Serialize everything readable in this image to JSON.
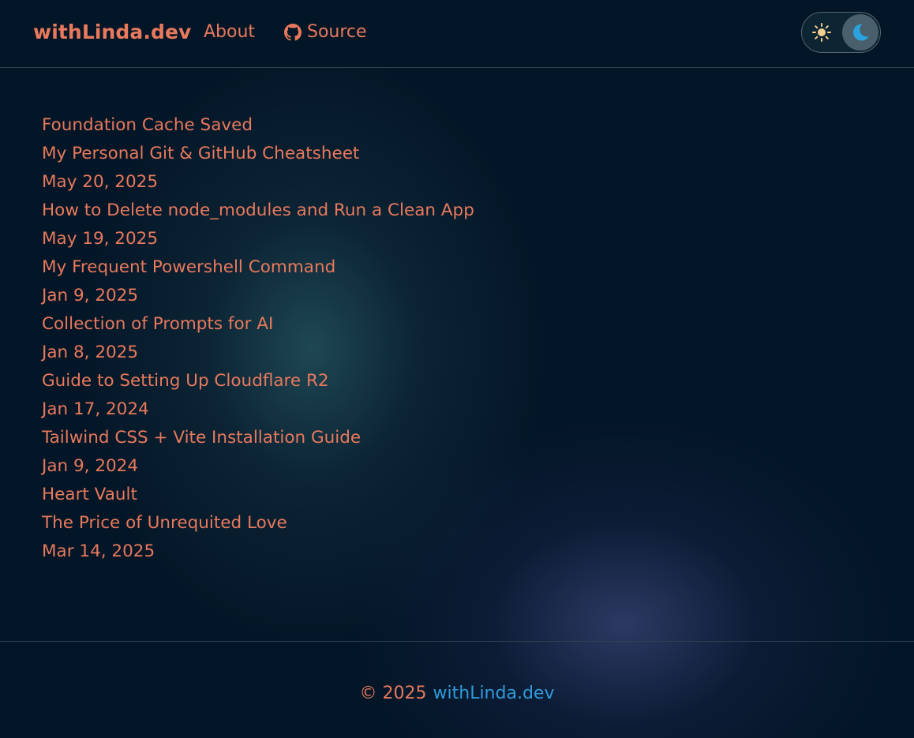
{
  "colors": {
    "accent": "#e8795c",
    "link_blue": "#2f9bd9",
    "background": "#031627",
    "divider": "#2f4250"
  },
  "header": {
    "brand": "withLinda.dev",
    "nav": {
      "about": "About",
      "source": "Source",
      "source_icon": "github-icon"
    },
    "theme_toggle": {
      "options": [
        "light",
        "dark"
      ],
      "selected": "dark",
      "light_icon": "sun-icon",
      "dark_icon": "moon-icon"
    }
  },
  "main": {
    "items": [
      "Foundation Cache Saved",
      "My Personal Git & GitHub Cheatsheet",
      "May 20, 2025",
      "How to Delete node_modules and Run a Clean App",
      "May 19, 2025",
      "My Frequent Powershell Command",
      "Jan 9, 2025",
      "Collection of Prompts for AI",
      "Jan 8, 2025",
      "Guide to Setting Up Cloudflare R2",
      "Jan 17, 2024",
      "Tailwind CSS + Vite Installation Guide",
      "Jan 9, 2024",
      "Heart Vault",
      "The Price of Unrequited Love",
      "Mar 14, 2025"
    ]
  },
  "footer": {
    "copyright": "© 2025",
    "link": "withLinda.dev"
  }
}
